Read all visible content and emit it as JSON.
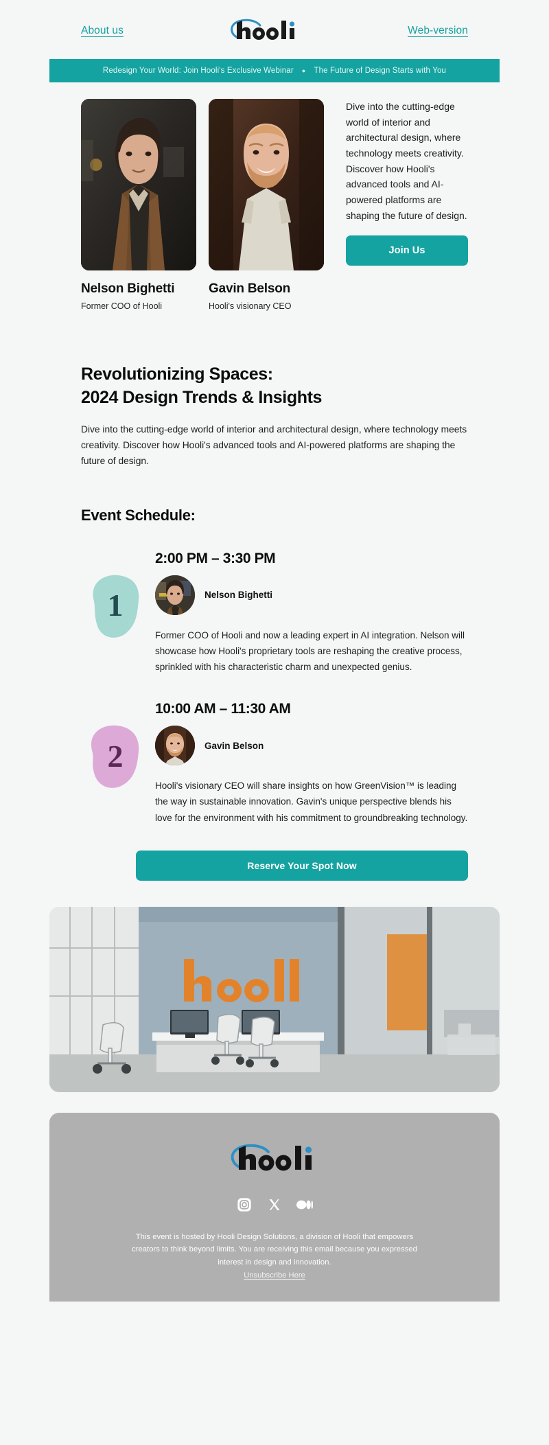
{
  "header": {
    "about_link": "About us ",
    "web_version_link": "Web-version",
    "logo_text": "hooli"
  },
  "ribbon": {
    "left_text": "Redesign Your World: Join Hooli's Exclusive Webinar",
    "separator": "●",
    "right_text": "The Future of Design Starts with You",
    "background_color": "#14a3a0"
  },
  "hero": {
    "speakers": [
      {
        "name": "Nelson Bighetti",
        "role": "Former COO of Hooli"
      },
      {
        "name": "Gavin Belson",
        "role": "Hooli's visionary CEO"
      }
    ],
    "copy": "Dive into the cutting-edge world of interior and architectural design, where technology meets creativity. Discover how Hooli's advanced tools and AI-powered platforms are shaping the future of design.",
    "join_button": "Join Us"
  },
  "main": {
    "headline_line1": "Revolutionizing Spaces:",
    "headline_line2": "2024 Design Trends & Insights",
    "lead": "Dive into the cutting-edge world of interior and architectural design, where technology meets creativity. Discover how Hooli's advanced tools and AI-powered platforms are shaping the future of design.",
    "schedule_title": "Event Schedule:",
    "sessions": [
      {
        "number": "1",
        "time": "2:00 PM – 3:30 PM",
        "speaker": "Nelson Bighetti",
        "description": "Former COO of Hooli and now a leading expert in AI integration. Nelson will showcase how Hooli's proprietary tools are reshaping the creative process, sprinkled with his characteristic charm and unexpected genius.",
        "blob_color": "#a4d8d1",
        "number_color": "#234b52"
      },
      {
        "number": "2",
        "time": "10:00 AM – 11:30 AM",
        "speaker": "Gavin Belson",
        "description": "Hooli's visionary CEO will share insights on how GreenVision™ is leading the way in sustainable innovation. Gavin's unique perspective blends his love for the environment with his commitment to groundbreaking technology.",
        "blob_color": "#ddaad8",
        "number_color": "#5a2a55"
      }
    ],
    "cta_button": "Reserve Your Spot Now"
  },
  "office_image": {
    "wall_logo_text": "hooli"
  },
  "footer": {
    "logo_text": "hooli",
    "socials": [
      {
        "name": "instagram-icon"
      },
      {
        "name": "x-twitter-icon"
      },
      {
        "name": "medium-icon"
      }
    ],
    "note": "This event is hosted by Hooli Design Solutions, a division of Hooli that empowers creators to think beyond limits. You are receiving this email because you expressed interest in design and innovation.",
    "unsubscribe": "Unsubscribe Here",
    "background_color": "#b0b0b0"
  }
}
